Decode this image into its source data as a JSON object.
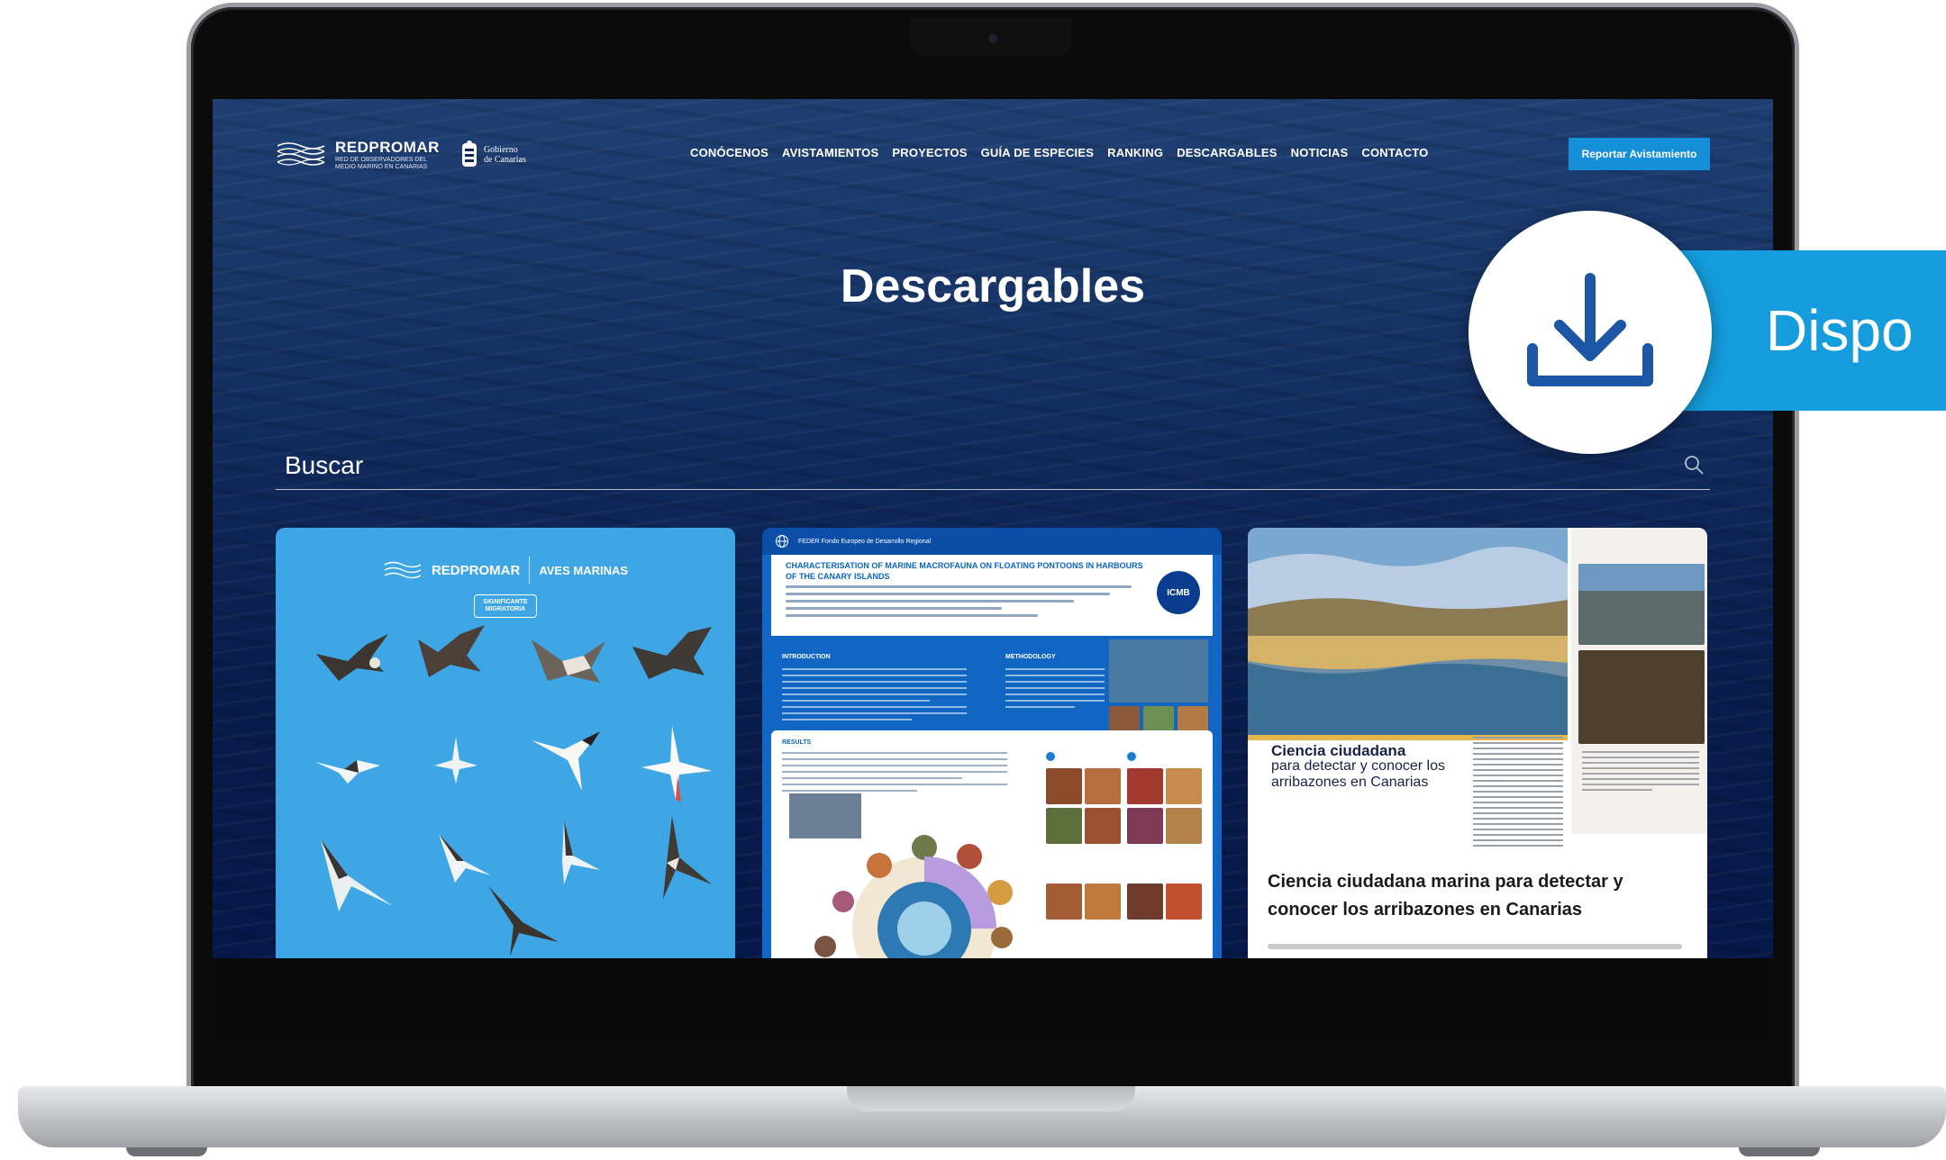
{
  "header": {
    "brand": "REDPROMAR",
    "brand_sub": "RED DE OBSERVADORES DEL MEDIO MARINO EN CANARIAS",
    "gov_line1": "Gobierno",
    "gov_line2": "de Canarias",
    "nav": [
      "CONÓCENOS",
      "AVISTAMIENTOS",
      "PROYECTOS",
      "GUÍA DE ESPECIES",
      "RANKING",
      "DESCARGABLES",
      "NOTICIAS",
      "CONTACTO"
    ],
    "cta": "Reportar Avistamiento"
  },
  "page": {
    "title": "Descargables",
    "search_placeholder": "Buscar"
  },
  "cards": [
    {
      "brand": "REDPROMAR",
      "category": "AVES MARINAS",
      "badge": "SIGNIFICANTE MIGRATORIA"
    },
    {
      "topbar": "FEDER   Fondo Europeo de Desarrollo Regional",
      "title": "CHARACTERISATION OF MARINE MACROFAUNA ON FLOATING PONTOONS IN HARBOURS OF THE CANARY ISLANDS",
      "logo": "ICMB",
      "sections": [
        "INTRODUCTION",
        "METHODOLOGY",
        "RESULTS"
      ]
    },
    {
      "mag_heading": "Ciencia ciudadana",
      "mag_subheading": "para detectar y conocer los arribazones en Canarias",
      "title": "Ciencia ciudadana marina para detectar y conocer los arribazones en Canarias"
    }
  ],
  "overlay": {
    "label": "Dispo",
    "icon": "download-icon"
  },
  "colors": {
    "accent": "#1590d8",
    "banner": "#159cdc",
    "hero_bg": "#0e2658",
    "download_blue": "#1c57a5"
  }
}
